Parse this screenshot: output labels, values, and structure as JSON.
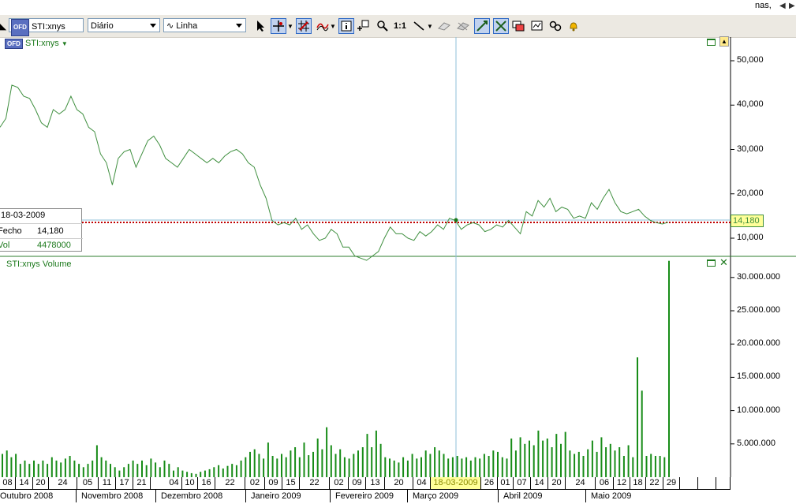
{
  "topbar": {
    "right_text": "nas,"
  },
  "toolbar": {
    "symbol_value": "STI:xnys",
    "period_value": "Diário",
    "chart_type_value": "Linha"
  },
  "price_panel": {
    "label": "STI:xnys",
    "y_ticks": [
      "50,000",
      "40,000",
      "30,000",
      "20,000",
      "10,000"
    ],
    "current_value": "14,180"
  },
  "volume_panel": {
    "label": "STI:xnys Volume",
    "y_ticks": [
      "30.000.000",
      "25.000.000",
      "20.000.000",
      "15.000.000",
      "10.000.000",
      "5.000.000"
    ]
  },
  "info_box": {
    "date": "18-03-2009",
    "close_label": "Fecho",
    "close_value": "14,180",
    "vol_label": "Vol",
    "vol_value": "4478000"
  },
  "x_axis": {
    "days": [
      "08",
      "14",
      "20",
      "24",
      "05",
      "11",
      "17",
      "21",
      "04",
      "10",
      "16",
      "22",
      "02",
      "09",
      "15",
      "22",
      "02",
      "09",
      "13",
      "20",
      "04",
      "18-03-2009",
      "26",
      "01",
      "07",
      "14",
      "20",
      "24",
      "06",
      "12",
      "18",
      "22",
      "29"
    ],
    "months": [
      "Outubro 2008",
      "Novembro 2008",
      "Dezembro 2008",
      "Janeiro 2009",
      "Fevereiro 2009",
      "Março 2009",
      "Abril 2009",
      "Maio 2009"
    ]
  },
  "colors": {
    "line": "#3f8f3f",
    "volume": "#178c17",
    "crosshair": "#8fbfd8",
    "reference": "#c00000",
    "highlight": "#ffff99"
  },
  "chart_data": [
    {
      "type": "line",
      "series": [
        {
          "values": [
            35,
            37,
            44.5,
            44,
            42,
            41.5,
            39,
            36,
            35,
            39,
            38,
            39,
            42,
            39,
            38,
            35,
            34,
            29,
            27,
            22,
            28,
            29.5,
            30,
            26,
            29,
            32,
            33,
            31,
            28,
            27,
            26,
            28,
            30,
            29,
            28,
            27,
            28,
            27,
            28.5,
            29.5,
            30,
            29,
            27,
            26,
            22,
            19,
            14,
            13,
            13.5,
            13,
            14.5,
            12,
            13,
            11,
            9.5,
            10,
            12,
            11,
            8,
            8,
            6,
            5.5,
            5,
            6,
            7,
            10,
            12.5,
            11,
            11,
            10,
            9.5,
            11.5,
            10.5,
            11.5,
            13,
            12,
            14.5,
            14,
            12,
            13,
            13.5,
            13,
            11.5,
            12,
            13,
            12.5,
            14,
            12.5,
            11,
            16,
            15,
            18.5,
            17,
            19,
            16,
            17,
            16.5,
            14.5,
            15,
            14.5,
            18,
            16.5,
            19,
            21,
            18,
            16,
            15.5,
            16,
            16.5,
            15,
            14,
            13.5,
            13.2,
            13.6
          ]
        }
      ],
      "ylim": [
        0,
        55000
      ],
      "y_ticks": [
        10000,
        20000,
        30000,
        40000,
        50000
      ]
    },
    {
      "type": "bar",
      "series": [
        {
          "values": [
            3.5,
            4,
            3,
            3.5,
            2,
            2.5,
            2,
            2.5,
            2,
            2.5,
            2,
            3,
            2.5,
            2.2,
            2.8,
            3.2,
            2.5,
            2,
            1.5,
            2,
            2.5,
            4.8,
            3,
            2.5,
            2,
            1.5,
            1,
            1.5,
            2,
            2.5,
            2,
            2.5,
            1.8,
            2.8,
            2.2,
            1.5,
            2.5,
            2,
            1,
            1.5,
            1,
            0.8,
            0.6,
            0.5,
            0.8,
            1,
            1.2,
            1.5,
            1.8,
            1.3,
            1.7,
            2,
            1.8,
            2.5,
            3,
            3.8,
            4.2,
            3.5,
            2.8,
            5.2,
            3.2,
            2.8,
            3.5,
            3,
            4,
            4.5,
            3,
            5.2,
            3.3,
            3.8,
            5.8,
            4.2,
            7.5,
            4.8,
            3.5,
            4.2,
            3,
            2.8,
            3.5,
            4,
            4.5,
            6.5,
            4.5,
            7,
            5,
            3,
            2.8,
            2.5,
            2.2,
            3,
            2.5,
            3.5,
            2.8,
            3,
            4,
            3.5,
            4.5,
            4,
            3.5,
            2.8,
            3,
            3.2,
            2.8,
            3,
            2.5,
            3,
            2.8,
            3.5,
            3.2,
            4,
            3.8,
            3,
            2.8,
            5.8,
            4,
            6,
            5,
            5.5,
            4.8,
            7,
            5.5,
            5.8,
            4.5,
            6.5,
            5,
            6.8,
            4,
            3.5,
            3.8,
            3.2,
            4.2,
            5.5,
            3.8,
            6,
            4.5,
            5,
            4,
            4.5,
            3.2,
            4.8,
            3,
            18,
            13,
            3.2,
            3.5,
            3.2,
            3.2,
            3,
            32.5
          ]
        }
      ],
      "ylim": [
        0,
        33000000
      ],
      "y_ticks": [
        5000000,
        10000000,
        15000000,
        20000000,
        25000000,
        30000000
      ]
    }
  ]
}
